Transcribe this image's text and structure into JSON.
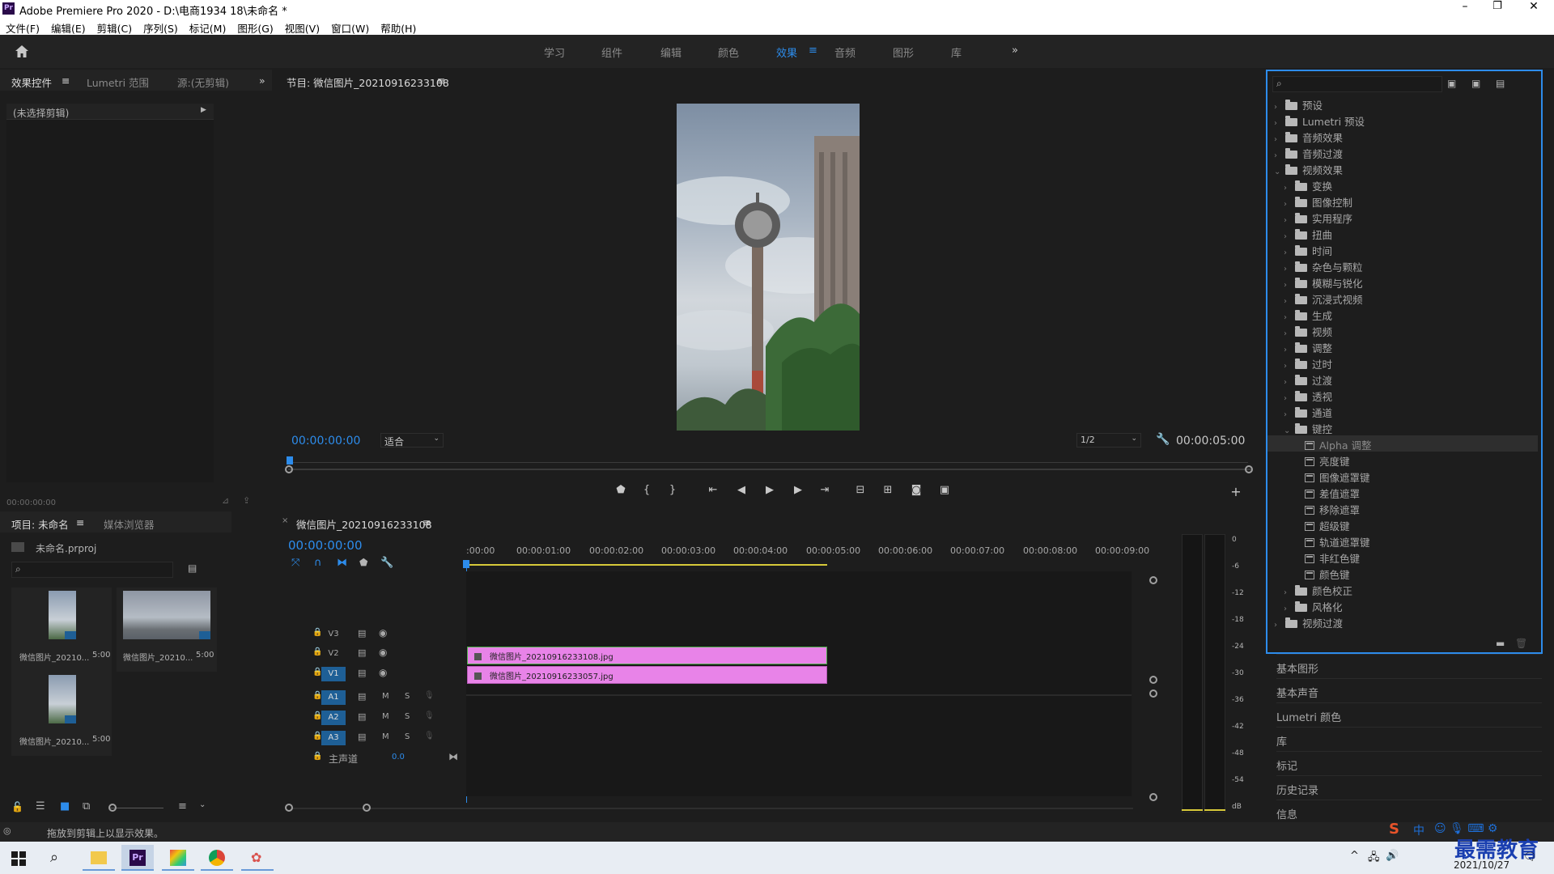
{
  "app": {
    "title": "Adobe Premiere Pro 2020 - D:\\电商1934 18\\未命名 *",
    "logo": "Pr"
  },
  "menu": [
    "文件(F)",
    "编辑(E)",
    "剪辑(C)",
    "序列(S)",
    "标记(M)",
    "图形(G)",
    "视图(V)",
    "窗口(W)",
    "帮助(H)"
  ],
  "workspaces": {
    "tabs": [
      "学习",
      "组件",
      "编辑",
      "颜色",
      "效果",
      "音频",
      "图形",
      "库"
    ],
    "active": "效果",
    "more": "»"
  },
  "effect_controls": {
    "tabs": [
      "效果控件",
      "Lumetri 范围",
      "源:(无剪辑)"
    ],
    "no_clip": "(未选择剪辑)",
    "timecode": "00:00:00:00"
  },
  "program_monitor": {
    "title": "节目: 微信图片_20210916233108",
    "timecode": "00:00:00:00",
    "fit": "适合",
    "resolution": "1/2",
    "duration": "00:00:05:00"
  },
  "project": {
    "tabs": [
      "项目: 未命名",
      "媒体浏览器"
    ],
    "file": "未命名.prproj",
    "items": [
      {
        "name": "微信图片_20210...",
        "duration": "5:00"
      },
      {
        "name": "微信图片_20210...",
        "duration": "5:00"
      },
      {
        "name": "微信图片_20210...",
        "duration": "5:00"
      }
    ]
  },
  "timeline": {
    "title": "微信图片_20210916233108",
    "timecode": "00:00:00:00",
    "ruler": [
      ":00:00",
      "00:00:01:00",
      "00:00:02:00",
      "00:00:03:00",
      "00:00:04:00",
      "00:00:05:00",
      "00:00:06:00",
      "00:00:07:00",
      "00:00:08:00",
      "00:00:09:00"
    ],
    "video_tracks": [
      "V3",
      "V2",
      "V1"
    ],
    "audio_tracks": [
      "A1",
      "A2",
      "A3"
    ],
    "master": {
      "label": "主声道",
      "value": "0.0"
    },
    "mute": "M",
    "solo": "S",
    "clips": [
      {
        "track": "V2",
        "name": "微信图片_20210916233108.jpg"
      },
      {
        "track": "V1",
        "name": "微信图片_20210916233057.jpg"
      }
    ]
  },
  "audio_meter": {
    "scale": [
      "0",
      "-6",
      "-12",
      "-18",
      "-24",
      "-30",
      "-36",
      "-42",
      "-48",
      "-54",
      "dB"
    ]
  },
  "effects": {
    "tree": [
      {
        "label": "预设",
        "level": 0,
        "type": "folder",
        "open": false
      },
      {
        "label": "Lumetri 预设",
        "level": 0,
        "type": "folder",
        "open": false
      },
      {
        "label": "音频效果",
        "level": 0,
        "type": "folder",
        "open": false
      },
      {
        "label": "音频过渡",
        "level": 0,
        "type": "folder",
        "open": false
      },
      {
        "label": "视频效果",
        "level": 0,
        "type": "folder",
        "open": true
      },
      {
        "label": "变换",
        "level": 1,
        "type": "folder",
        "open": false
      },
      {
        "label": "图像控制",
        "level": 1,
        "type": "folder",
        "open": false
      },
      {
        "label": "实用程序",
        "level": 1,
        "type": "folder",
        "open": false
      },
      {
        "label": "扭曲",
        "level": 1,
        "type": "folder",
        "open": false
      },
      {
        "label": "时间",
        "level": 1,
        "type": "folder",
        "open": false
      },
      {
        "label": "杂色与颗粒",
        "level": 1,
        "type": "folder",
        "open": false
      },
      {
        "label": "模糊与锐化",
        "level": 1,
        "type": "folder",
        "open": false
      },
      {
        "label": "沉浸式视频",
        "level": 1,
        "type": "folder",
        "open": false
      },
      {
        "label": "生成",
        "level": 1,
        "type": "folder",
        "open": false
      },
      {
        "label": "视频",
        "level": 1,
        "type": "folder",
        "open": false
      },
      {
        "label": "调整",
        "level": 1,
        "type": "folder",
        "open": false
      },
      {
        "label": "过时",
        "level": 1,
        "type": "folder",
        "open": false
      },
      {
        "label": "过渡",
        "level": 1,
        "type": "folder",
        "open": false
      },
      {
        "label": "透视",
        "level": 1,
        "type": "folder",
        "open": false
      },
      {
        "label": "通道",
        "level": 1,
        "type": "folder",
        "open": false
      },
      {
        "label": "键控",
        "level": 1,
        "type": "folder",
        "open": true
      },
      {
        "label": "Alpha 调整",
        "level": 2,
        "type": "effect",
        "selected": true
      },
      {
        "label": "亮度键",
        "level": 2,
        "type": "effect"
      },
      {
        "label": "图像遮罩键",
        "level": 2,
        "type": "effect"
      },
      {
        "label": "差值遮罩",
        "level": 2,
        "type": "effect"
      },
      {
        "label": "移除遮罩",
        "level": 2,
        "type": "effect"
      },
      {
        "label": "超级键",
        "level": 2,
        "type": "effect"
      },
      {
        "label": "轨道遮罩键",
        "level": 2,
        "type": "effect"
      },
      {
        "label": "非红色键",
        "level": 2,
        "type": "effect"
      },
      {
        "label": "颜色键",
        "level": 2,
        "type": "effect"
      },
      {
        "label": "颜色校正",
        "level": 1,
        "type": "folder",
        "open": false
      },
      {
        "label": "风格化",
        "level": 1,
        "type": "folder",
        "open": false
      },
      {
        "label": "视频过渡",
        "level": 0,
        "type": "folder",
        "open": false
      }
    ]
  },
  "right_panels": [
    "基本图形",
    "基本声音",
    "Lumetri 颜色",
    "库",
    "标记",
    "历史记录",
    "信息"
  ],
  "status": {
    "hint": "拖放到剪辑上以显示效果。"
  },
  "taskbar": {
    "time": "",
    "date": "2021/10/27",
    "ime": "中",
    "watermark": "最需教育"
  },
  "colors": {
    "accent": "#2d8ceb",
    "clip": "#e883e8",
    "track_on": "#1e5f96"
  }
}
